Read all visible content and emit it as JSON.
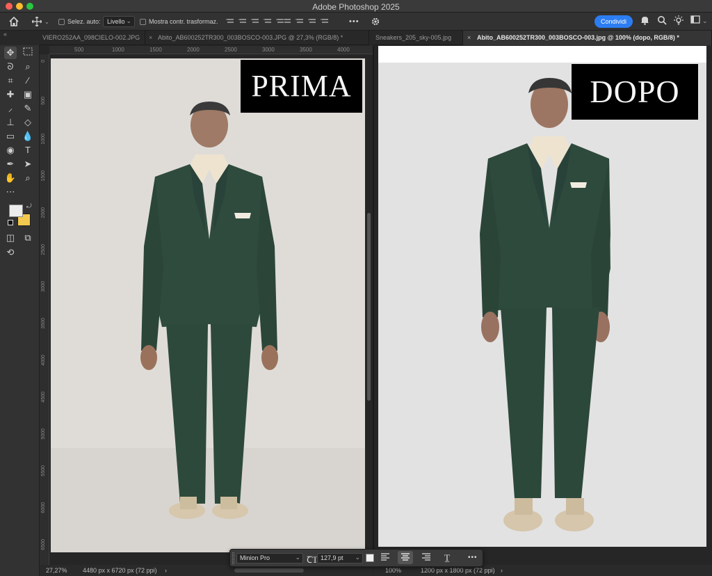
{
  "app": {
    "title": "Adobe Photoshop 2025"
  },
  "options_bar": {
    "auto_select_label": "Selez. auto:",
    "auto_select_value": "Livello",
    "show_transform_label": "Mostra contr. trasformaz.",
    "share_button": "Condividi",
    "more_glyph": "•••"
  },
  "tabs_left": [
    {
      "label": "VIERO252AA_098CIELO-002.JPG",
      "active": false
    },
    {
      "label": "Abito_AB600252TR300_003BOSCO-003.JPG @ 27,3% (RGB/8) *",
      "active": false
    }
  ],
  "tabs_right": [
    {
      "label": "Sneakers_205_sky-005.jpg",
      "active": false
    },
    {
      "label": "Abito_AB600252TR300_003BOSCO-003.jpg @ 100% (dopo, RGB/8) *",
      "active": true
    }
  ],
  "ruler_h_left": [
    "500",
    "1000",
    "1500",
    "2000",
    "2500",
    "3000",
    "3500",
    "4000"
  ],
  "ruler_v_left": [
    "0",
    "500",
    "1000",
    "1500",
    "2000",
    "2500",
    "3000",
    "3500",
    "4000",
    "4500",
    "5000",
    "5500",
    "6000",
    "6500"
  ],
  "canvas_left": {
    "label_text": "PRIMA",
    "background": "#dfdcd8"
  },
  "canvas_right": {
    "label_text": "DOPO",
    "background": "#e3e2e2"
  },
  "status_left": {
    "zoom": "27,27%",
    "doc_size": "4480 px x 6720 px (72 ppi)",
    "arrow": "›"
  },
  "status_right": {
    "zoom": "100%",
    "doc_size": "1200 px x 1800 px (72 ppi)",
    "arrow": "›"
  },
  "type_bar": {
    "font_family": "Minion Pro",
    "font_size": "127,9 pt",
    "more_glyph": "•••"
  },
  "colors": {
    "accent": "#2c7df2",
    "suit": "#2f4b3d",
    "foreground_swatch": "#ececec",
    "background_swatch": "#f3c84f"
  }
}
